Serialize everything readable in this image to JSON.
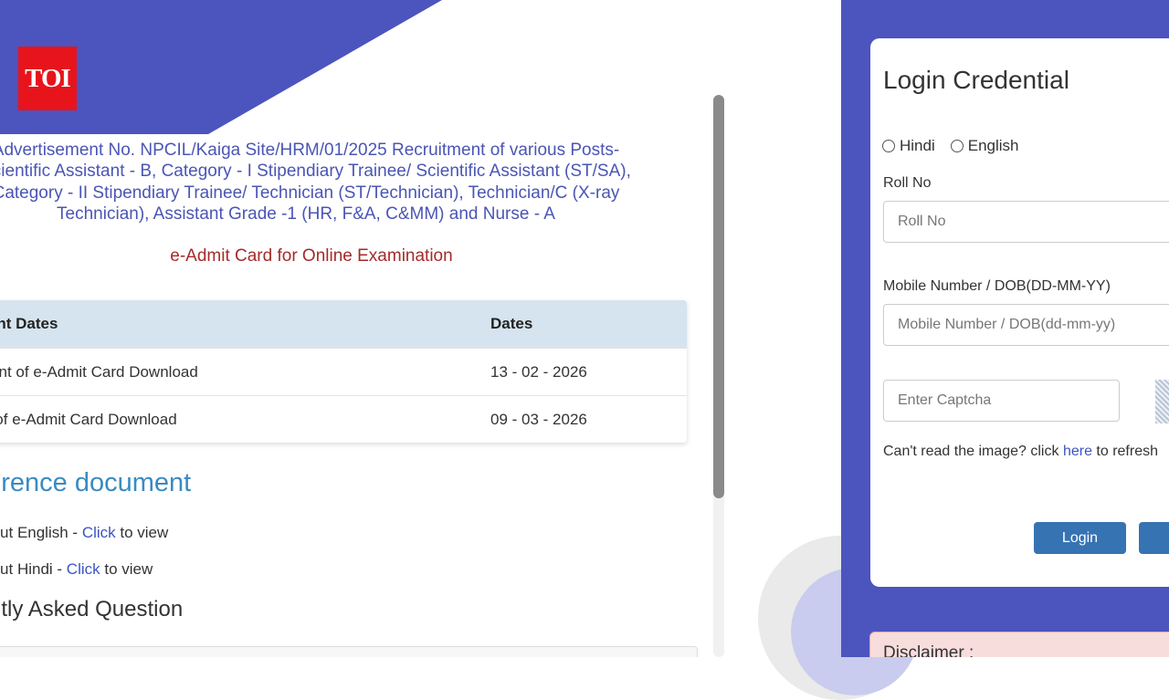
{
  "logo": {
    "text": "TOI",
    "color": "#e8141b"
  },
  "advertisement": {
    "lines": [
      "Advertisement No. NPCIL/Kaiga Site/HRM/01/2025 Recruitment of various Posts-",
      "Scientific Assistant - B, Category - I Stipendiary Trainee/ Scientific Assistant (ST/SA),",
      "Category - II Stipendiary Trainee/ Technician (ST/Technician), Technician/C (X-ray",
      "Technician), Assistant Grade -1 (HR, F&A, C&MM) and Nurse - A"
    ],
    "subtitle": "e-Admit Card for Online Examination"
  },
  "dates_table": {
    "headers": [
      "Important Dates",
      "Dates"
    ],
    "rows": [
      [
        "Commencement of e-Admit Card Download",
        "13 - 02 - 2026"
      ],
      [
        "Closure of e-Admit Card Download",
        "09 - 03 - 2026"
      ]
    ]
  },
  "reference": {
    "heading": "Reference document",
    "items": [
      {
        "prefix": "Information handout English - ",
        "link": "Click",
        "suffix": " to view"
      },
      {
        "prefix": "Information handout Hindi - ",
        "link": "Click",
        "suffix": " to view"
      }
    ]
  },
  "faq": {
    "heading": "Frequently Asked Question"
  },
  "login": {
    "title": "Login Credential",
    "language_options": [
      "Hindi",
      "English"
    ],
    "roll_label": "Roll No",
    "roll_placeholder": "Roll No",
    "mobile_label": "Mobile Number / DOB(DD-MM-YY)",
    "mobile_placeholder": "Mobile Number / DOB(dd-mm-yy)",
    "captcha_placeholder": "Enter Captcha",
    "captcha_help_prefix": "Can't read the image? click ",
    "captcha_help_link": "here",
    "captcha_help_suffix": " to refresh",
    "login_button": "Login"
  },
  "disclaimer": {
    "title": "Disclaimer :"
  },
  "colors": {
    "brand_blue": "#4c54be",
    "title_blue": "#4a55b5",
    "subtitle_red": "#a52a2a",
    "table_header": "#d6e4ef",
    "button_blue": "#3673b2",
    "link_blue": "#3b55c4",
    "reference_blue": "#3a8bc1"
  }
}
